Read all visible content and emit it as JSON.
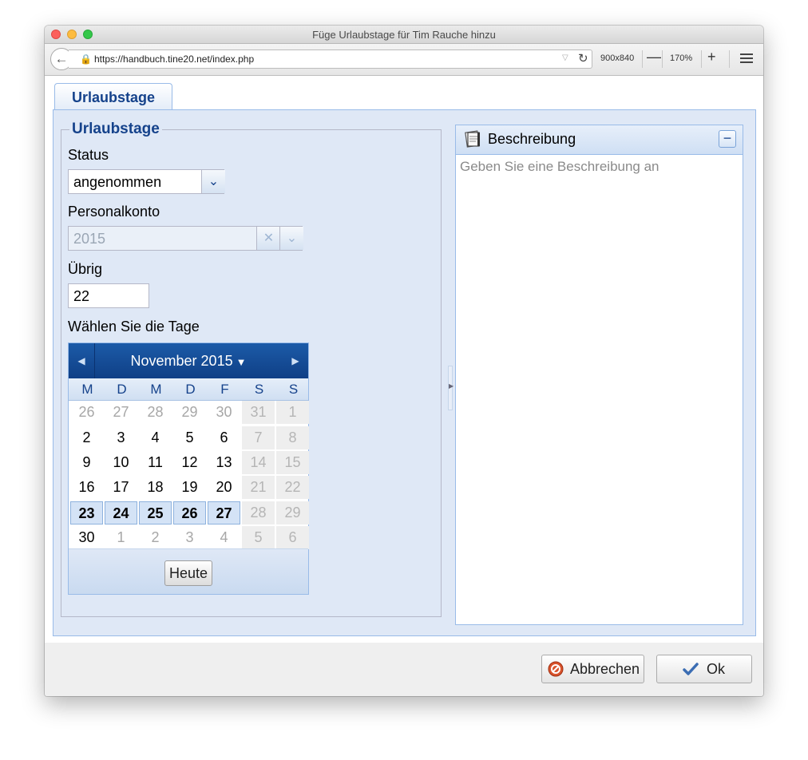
{
  "window": {
    "title": "Füge Urlaubstage für Tim Rauche hinzu"
  },
  "browser": {
    "url": "https://handbuch.tine20.net/index.php",
    "size": "900x840",
    "zoom_out": "—",
    "zoom": "170%",
    "zoom_in": "+"
  },
  "tab": {
    "label": "Urlaubstage"
  },
  "form": {
    "legend": "Urlaubstage",
    "status_label": "Status",
    "status_value": "angenommen",
    "account_label": "Personalkonto",
    "account_value": "2015",
    "remaining_label": "Übrig",
    "remaining_value": "22",
    "days_label": "Wählen Sie die Tage"
  },
  "calendar": {
    "month": "November 2015",
    "weekdays": [
      "M",
      "D",
      "M",
      "D",
      "F",
      "S",
      "S"
    ],
    "weeks": [
      [
        "26",
        "27",
        "28",
        "29",
        "30",
        "31",
        "1"
      ],
      [
        "2",
        "3",
        "4",
        "5",
        "6",
        "7",
        "8"
      ],
      [
        "9",
        "10",
        "11",
        "12",
        "13",
        "14",
        "15"
      ],
      [
        "16",
        "17",
        "18",
        "19",
        "20",
        "21",
        "22"
      ],
      [
        "23",
        "24",
        "25",
        "26",
        "27",
        "28",
        "29"
      ],
      [
        "30",
        "1",
        "2",
        "3",
        "4",
        "5",
        "6"
      ]
    ],
    "today_label": "Heute"
  },
  "description": {
    "title": "Beschreibung",
    "placeholder": "Geben Sie eine Beschreibung an"
  },
  "buttons": {
    "cancel": "Abbrechen",
    "ok": "Ok"
  }
}
